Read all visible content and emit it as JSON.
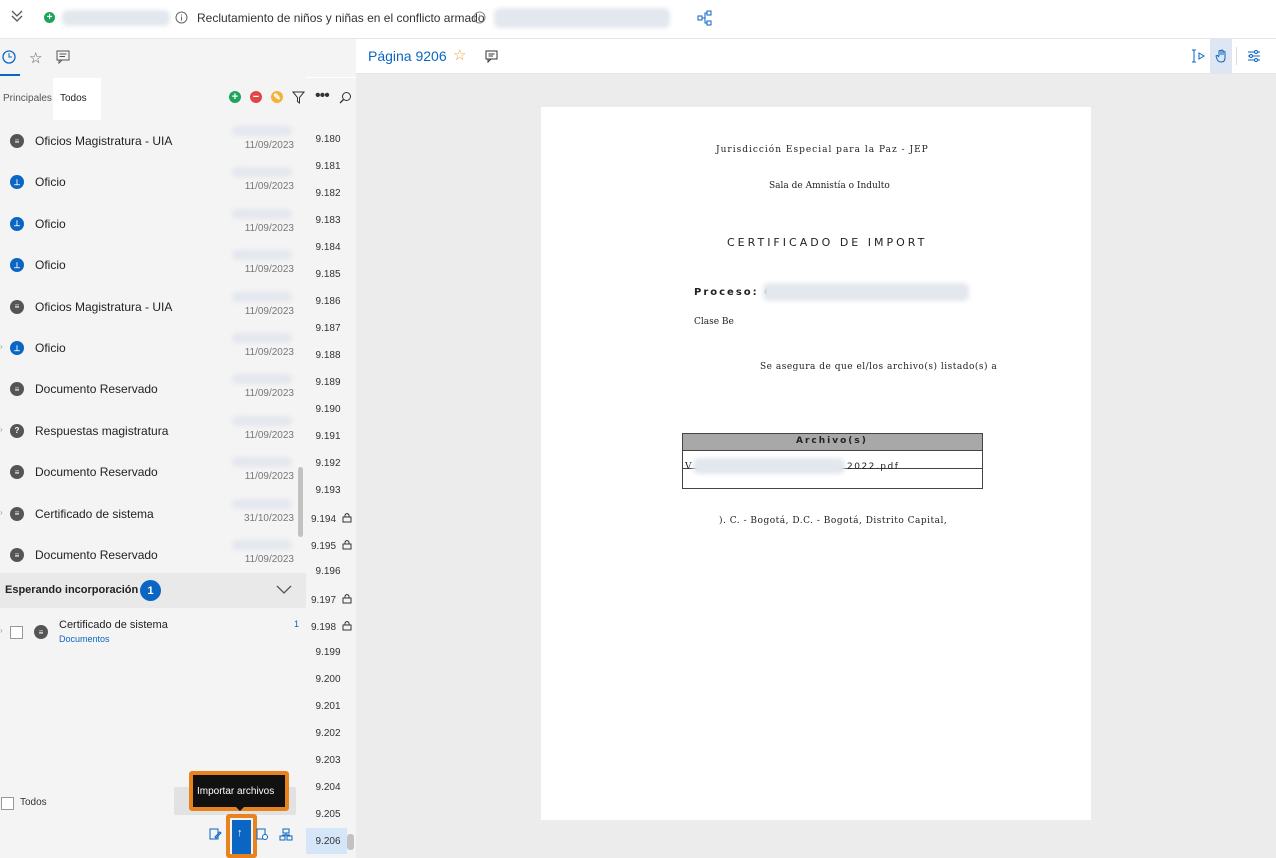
{
  "topbar": {
    "title": "Reclutamiento de niños y niñas en el conflicto armado"
  },
  "left_tabs": {
    "subtabs": [
      "Principales",
      "Todos"
    ]
  },
  "documents": [
    {
      "title": "Oficios Magistratura - UIA",
      "date": "11/09/2023",
      "icon": "document-icon"
    },
    {
      "title": "Oficio",
      "date": "11/09/2023",
      "icon": "stamp-icon"
    },
    {
      "title": "Oficio",
      "date": "11/09/2023",
      "icon": "stamp-icon"
    },
    {
      "title": "Oficio",
      "date": "11/09/2023",
      "icon": "stamp-icon"
    },
    {
      "title": "Oficios Magistratura - UIA",
      "date": "11/09/2023",
      "icon": "document-icon"
    },
    {
      "title": "Oficio",
      "date": "11/09/2023",
      "icon": "stamp-icon"
    },
    {
      "title": "Documento Reservado",
      "date": "11/09/2023",
      "icon": "document-icon"
    },
    {
      "title": "Respuestas magistratura",
      "date": "11/09/2023",
      "icon": "question-icon"
    },
    {
      "title": "Documento Reservado",
      "date": "11/09/2023",
      "icon": "document-icon"
    },
    {
      "title": "Certificado de sistema",
      "date": "31/10/2023",
      "icon": "document-icon"
    },
    {
      "title": "Documento Reservado",
      "date": "11/09/2023",
      "icon": "document-icon"
    }
  ],
  "waiting": {
    "label": "Esperando incorporación",
    "count": "1",
    "item_title": "Certificado de sistema",
    "item_sub": "Documentos",
    "item_count": "1"
  },
  "footer": {
    "todos_label": "Todos",
    "tooltip": "Importar archivos"
  },
  "page_numbers": [
    "9.180",
    "9.181",
    "9.182",
    "9.183",
    "9.184",
    "9.185",
    "9.186",
    "9.187",
    "9.188",
    "9.189",
    "9.190",
    "9.191",
    "9.192",
    "9.193",
    "9.194",
    "9.195",
    "9.196",
    "9.197",
    "9.198",
    "9.199",
    "9.200",
    "9.201",
    "9.202",
    "9.203",
    "9.204",
    "9.205",
    "9.206"
  ],
  "locked_pages": [
    "9.194",
    "9.195",
    "9.197",
    "9.198"
  ],
  "viewer": {
    "page_label": "Página 9206"
  },
  "document_page": {
    "line1": "Jurisdicción Especial para la Paz - JEP",
    "line2": "Sala de Amnistía o Indulto",
    "heading": "CERTIFICADO DE IMPORT",
    "proceso": "Proceso: C",
    "clase": "Clase Be",
    "asegura": "Se asegura de que el/los archivo(s) listado(s) a",
    "table_header": "Archivo(s)",
    "file_prefix": "V",
    "file_suffix": "2022.pdf",
    "location": "). C. - Bogotá, D.C. - Bogotá, Distrito Capital,"
  },
  "colors": {
    "accent": "#0a66c2",
    "highlight": "#e8821e",
    "green": "#20a35a",
    "red": "#e04646"
  }
}
